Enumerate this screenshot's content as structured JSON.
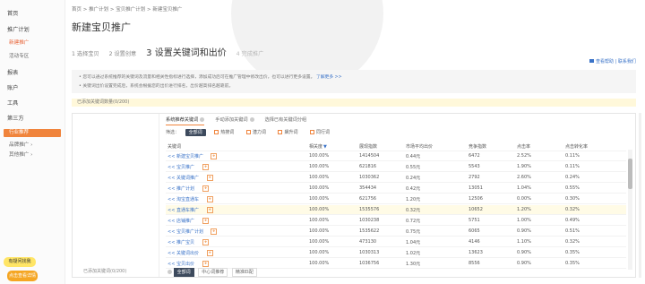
{
  "sidebar": {
    "home": "首页",
    "promotion": "推广计划",
    "sub_new": "新建推广",
    "sub_activity": "活动专区",
    "report": "报表",
    "account": "账户",
    "tools": "工具",
    "third_party": "第三方",
    "orange_label": "行业推荐",
    "extra1": "品牌推广 ›",
    "extra2": "其他推广 ›",
    "mascot_top": "有疑问找我",
    "mascot_bottom": "点击查看详情"
  },
  "breadcrumb": "首页 > 推广计划 > 宝贝推广计划 > 新建宝贝推广",
  "page_title": "新建宝贝推广",
  "steps": [
    {
      "num": "1",
      "label": "选择宝贝"
    },
    {
      "num": "2",
      "label": "设置创意"
    },
    {
      "num": "3",
      "label": "设置关键词和出价"
    },
    {
      "num": "4",
      "label": "完成推广"
    }
  ],
  "right_links": "查看帮助 | 联系我们",
  "notice": {
    "line1": "• 您可以通过系统推荐的关键词及流量和相关性指标进行选择，添加成功后可在推广管理中修改出价，也可以进行更多设置。",
    "line1_link": "了解更多 >>",
    "line2": "• 关键词出价设置完成后，系统会根据您的出价进行排名，出价越高排名越靠前。"
  },
  "yellow_bar": "已添加关键词数量(0/200)",
  "kw_tabs": [
    "系统推荐关键词",
    "手动添加关键词",
    "选择已有关键词分组"
  ],
  "filter": {
    "label": "筛选：",
    "buttons": [
      "全部词",
      "热搜词",
      "潜力词",
      "飙升词",
      "同行词"
    ]
  },
  "table": {
    "headers": [
      "关键词",
      "相关度",
      "展现指数",
      "市场平均出价",
      "竞争指数",
      "点击率",
      "点击转化率"
    ],
    "rows": [
      [
        "<< 新建宝贝推广",
        "100.00%",
        "1414504",
        "0.44元",
        "6472",
        "2.52%",
        "0.11%"
      ],
      [
        "<< 宝贝推广",
        "100.00%",
        "621816",
        "0.55元",
        "5543",
        "1.90%",
        "0.11%"
      ],
      [
        "<< 关键词推广",
        "100.00%",
        "1030362",
        "0.24元",
        "2792",
        "2.60%",
        "0.24%"
      ],
      [
        "<< 推广计划",
        "100.00%",
        "354434",
        "0.42元",
        "13051",
        "1.04%",
        "0.55%"
      ],
      [
        "<< 淘宝直通车",
        "100.00%",
        "621756",
        "1.20元",
        "12506",
        "0.00%",
        "0.30%"
      ],
      [
        "<< 直通车推广",
        "100.00%",
        "1535576",
        "0.32元",
        "10652",
        "1.20%",
        "0.32%"
      ],
      [
        "<< 店铺推广",
        "100.00%",
        "1030238",
        "0.72元",
        "5751",
        "1.00%",
        "0.49%"
      ],
      [
        "<< 宝贝推广计划",
        "100.00%",
        "1535622",
        "0.75元",
        "6065",
        "0.90%",
        "0.51%"
      ],
      [
        "<< 推广宝贝",
        "100.00%",
        "473130",
        "1.04元",
        "4146",
        "1.10%",
        "0.32%"
      ],
      [
        "<< 关键词出价",
        "100.00%",
        "1030313",
        "1.02元",
        "13623",
        "0.90%",
        "0.35%"
      ],
      [
        "<< 宝贝出价",
        "100.00%",
        "1036756",
        "1.30元",
        "8556",
        "0.90%",
        "0.35%"
      ]
    ]
  },
  "left_footer": "已添加关键词(0/200)",
  "bottom_tabs": [
    "全部词",
    "中心词推荐",
    "精准匹配"
  ],
  "colors": {
    "accent": "#f0843c",
    "link": "#3a73c8",
    "dark_btn": "#3d4a5d"
  }
}
